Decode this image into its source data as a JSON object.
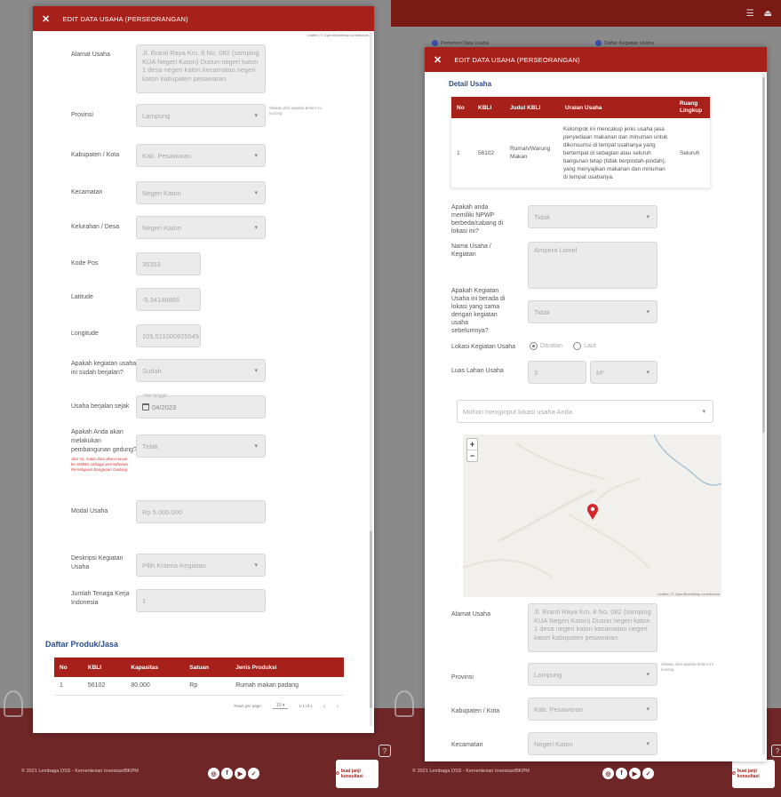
{
  "modal_title": "EDIT DATA USAHA (PERSEORANGAN)",
  "map_attribution": "Leaflet | © OpenStreetMap contributors",
  "footer": {
    "legal": "© 2021 Lembaga OSS - Kementerian Investasi/BKPM",
    "consult_label": "buat janji konsultasi"
  },
  "right_bg": {
    "crumb1": "Pemohon Data Usaha",
    "crumb2": "Daftar Kegiatan Usaha"
  },
  "left": {
    "alamat": {
      "label": "Alamat Usaha",
      "value": "Jl. Branti Raya Km. 8 No. 082 (samping KUA Negeri Katon) Dusun negeri katon 1 desa negeri katon kecamatan negeri katon kabupaten pesawaran"
    },
    "provinsi": {
      "label": "Provinsi",
      "value": "Lampung",
      "hint": "Silakan diisi apabila belum ini kosong"
    },
    "kabupaten": {
      "label": "Kabupaten / Kota",
      "value": "Kab. Pesawaran"
    },
    "kecamatan": {
      "label": "Kecamatan",
      "value": "Negeri Katon"
    },
    "kelurahan": {
      "label": "Kelurahan / Desa",
      "value": "Negeri Katon"
    },
    "kodepos": {
      "label": "Kode Pos",
      "value": "35353"
    },
    "latitude": {
      "label": "Latitude",
      "value": "-5.34148865"
    },
    "longitude": {
      "label": "Longitude",
      "value": "105.511000925545"
    },
    "berjalan": {
      "label": "Apakah kegiatan usaha ini sudah berjalan?",
      "value": "Sudah"
    },
    "sejak": {
      "label": "Usaha berjalan sejak",
      "float_label": "Pilih Tanggal",
      "value": "04/2023"
    },
    "bangun": {
      "label": "Apakah Anda akan melakukan pembangunan gedung?",
      "value": "Tidak",
      "red_hint": "Jika Ya, maka data akan masuk ke SIMBG sebagai permohonan Persetujuan Bangunan Gedung"
    },
    "modal": {
      "label": "Modal Usaha",
      "value": "Rp 5.000.000"
    },
    "deskripsi": {
      "label": "Deskripsi Kegiatan Usaha",
      "value": "Pilih Kriteria Kegiatan"
    },
    "tenaga": {
      "label": "Jumlah Tenaga Kerja Indonesia",
      "value": "1"
    },
    "produk": {
      "title": "Daftar Produk/Jasa",
      "headers": [
        "No",
        "KBLI",
        "Kapasitas",
        "Satuan",
        "Jenis Produksi"
      ],
      "rows": [
        [
          "1",
          "56102",
          "80.000",
          "Rp",
          "Rumah makan padang"
        ]
      ],
      "rows_per_page_label": "Rows per page:",
      "rows_per_page": "10",
      "range": "1-1 of 1"
    }
  },
  "right": {
    "detail_title": "Detail Usaha",
    "kbli_table": {
      "headers": [
        "No",
        "KBLI",
        "Judul KBLI",
        "Uraian Usaha",
        "Ruang Lingkup"
      ],
      "row": [
        "1",
        "56102",
        "Rumah/Warung Makan",
        "Kelompok ini mencakup jenis usaha jasa penyediaan makanan dan minuman untuk dikonsumsi di tempat usahanya yang bertempat di sebagian atau seluruh bangunan tetap (tidak berpindah-pindah), yang menyajikan makanan dan minuman di tempat usahanya.",
        "Seluruh"
      ]
    },
    "npwp": {
      "label": "Apakah anda memiliki NPWP berbeda/cabang di lokasi ini?",
      "value": "Tidak"
    },
    "nama": {
      "label": "Nama Usaha / Kegiatan",
      "value": "Ampera Lionel"
    },
    "lokasi_sama": {
      "label": "Apakah Kegiatan Usaha ini berada di lokasi yang sama dengan kegiatan usaha sebelumnya?",
      "value": "Tidak"
    },
    "lokasi_kegiatan": {
      "label": "Lokasi Kegiatan Usaha",
      "opt1": "Daratan",
      "opt2": "Laut"
    },
    "luas": {
      "label": "Luas Lahan Usaha",
      "value": "3",
      "unit": "M²"
    },
    "search": {
      "placeholder": "Mohon menginput lokasi usaha Anda"
    },
    "alamat": {
      "label": "Alamat Usaha",
      "value": "Jl. Branti Raya Km. 8 No. 082 (samping KUA Negeri Katon) Dusun negeri katon 1 desa negeri katon kecamatan negeri katon kabupaten pesawaran"
    },
    "provinsi": {
      "label": "Provinsi",
      "value": "Lampung",
      "hint": "Silakan diisi apabila belum ini kosong"
    },
    "kabupaten": {
      "label": "Kabupaten / Kota",
      "value": "Kab. Pesawaran"
    },
    "kecamatan": {
      "label": "Kecamatan",
      "value": "Negeri Katon"
    }
  },
  "colors": {
    "brand_red": "#a8201a",
    "title_blue": "#2b4b8a"
  }
}
